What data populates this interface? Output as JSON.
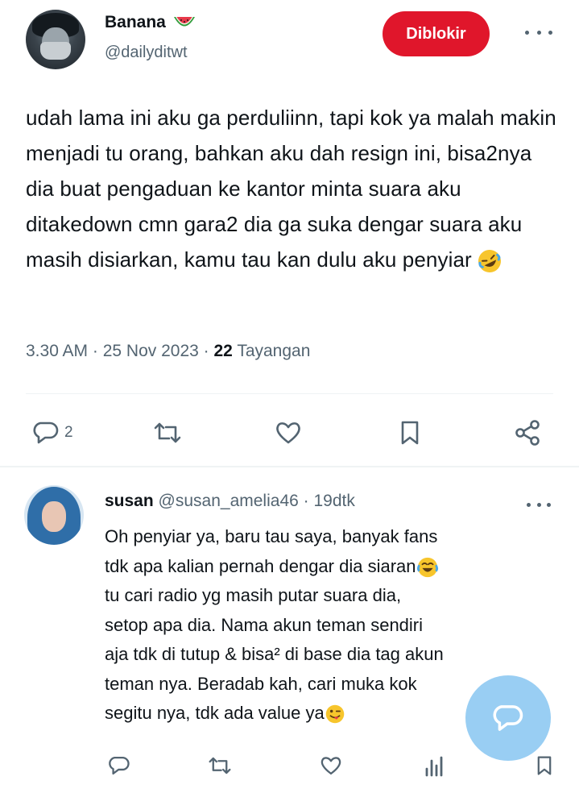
{
  "post": {
    "author_name": "Banana",
    "author_handle": "@dailyditwt",
    "blocked_label": "Diblokir",
    "text": "udah lama ini aku ga perduliinn, tapi kok ya malah makin menjadi tu orang, bahkan aku dah resign ini, bisa2nya dia buat pengaduan ke kantor minta suara aku ditakedown cmn gara2 dia ga suka dengar suara aku masih disiarkan, kamu tau kan dulu aku penyiar",
    "time": "3.30 AM",
    "date": "25 Nov 2023",
    "views_count": "22",
    "views_label": "Tayangan",
    "reply_count": "2"
  },
  "reply": {
    "author_name": "susan",
    "author_handle": "@susan_amelia46",
    "time_ago": "19dtk",
    "text_lines": [
      "Oh penyiar ya, baru tau saya, banyak fans",
      "tdk apa kalian pernah dengar dia siaran",
      "tu cari radio yg masih putar suara dia,",
      "setop apa dia. Nama akun teman sendiri",
      "aja tdk di tutup & bisa² di base dia tag akun",
      "teman nya. Beradab kah, cari muka kok",
      "segitu nya, tdk ada value ya"
    ]
  },
  "icons": {
    "name_badge": "watermelon-icon",
    "post_end": "rolling-laughing-emoji",
    "reply_line2": "tears-of-joy-emoji",
    "reply_end": "winking-tongue-emoji"
  },
  "colors": {
    "accent_red": "#e0162b",
    "fab_blue": "#8ec9f2",
    "muted": "#536471"
  }
}
